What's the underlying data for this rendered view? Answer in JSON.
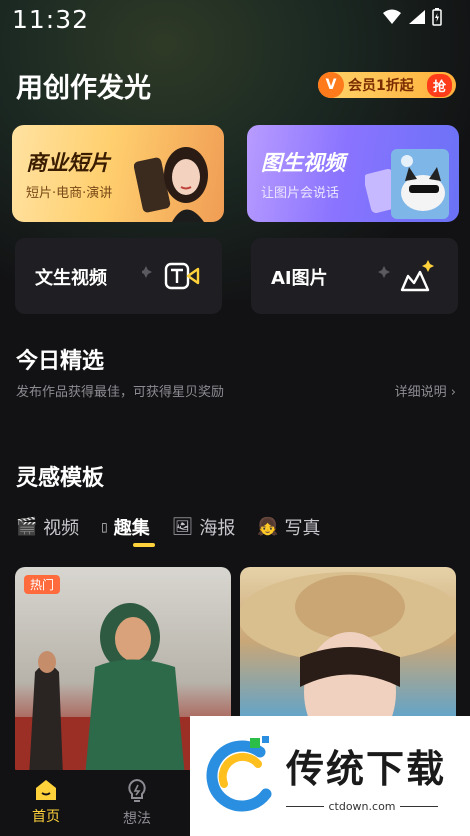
{
  "status_bar": {
    "time": "11:32"
  },
  "header": {
    "title": "用创作发光",
    "vip_badge": "会员1折起",
    "vip_action": "抢"
  },
  "feature_cards": [
    {
      "title": "商业短片",
      "subtitle": "短片·电商·演讲"
    },
    {
      "title": "图生视频",
      "subtitle": "让图片会说话"
    }
  ],
  "tools": [
    {
      "label": "文生视频",
      "icon": "text-to-video-icon"
    },
    {
      "label": "AI图片",
      "icon": "ai-image-icon"
    }
  ],
  "today": {
    "title": "今日精选",
    "subtitle": "发布作品获得最佳，可获得星贝奖励",
    "more": "详细说明"
  },
  "inspiration": {
    "title": "灵感模板",
    "tabs": [
      {
        "label": "视频",
        "icon": "clapper-icon",
        "active": false
      },
      {
        "label": "趣集",
        "icon": "box-icon",
        "active": true
      },
      {
        "label": "海报",
        "icon": "picture-icon",
        "active": false
      },
      {
        "label": "写真",
        "icon": "person-icon",
        "active": false
      }
    ],
    "cards": [
      {
        "tag": "热门"
      },
      {
        "tag": ""
      }
    ]
  },
  "bottom_nav": [
    {
      "label": "首页",
      "icon": "home-icon",
      "active": true
    },
    {
      "label": "想法",
      "icon": "bulb-icon",
      "active": false
    }
  ],
  "watermark": {
    "text": "传统下载",
    "url": "ctdown.com"
  },
  "colors": {
    "accent": "#ffd23c",
    "background": "#121214"
  }
}
